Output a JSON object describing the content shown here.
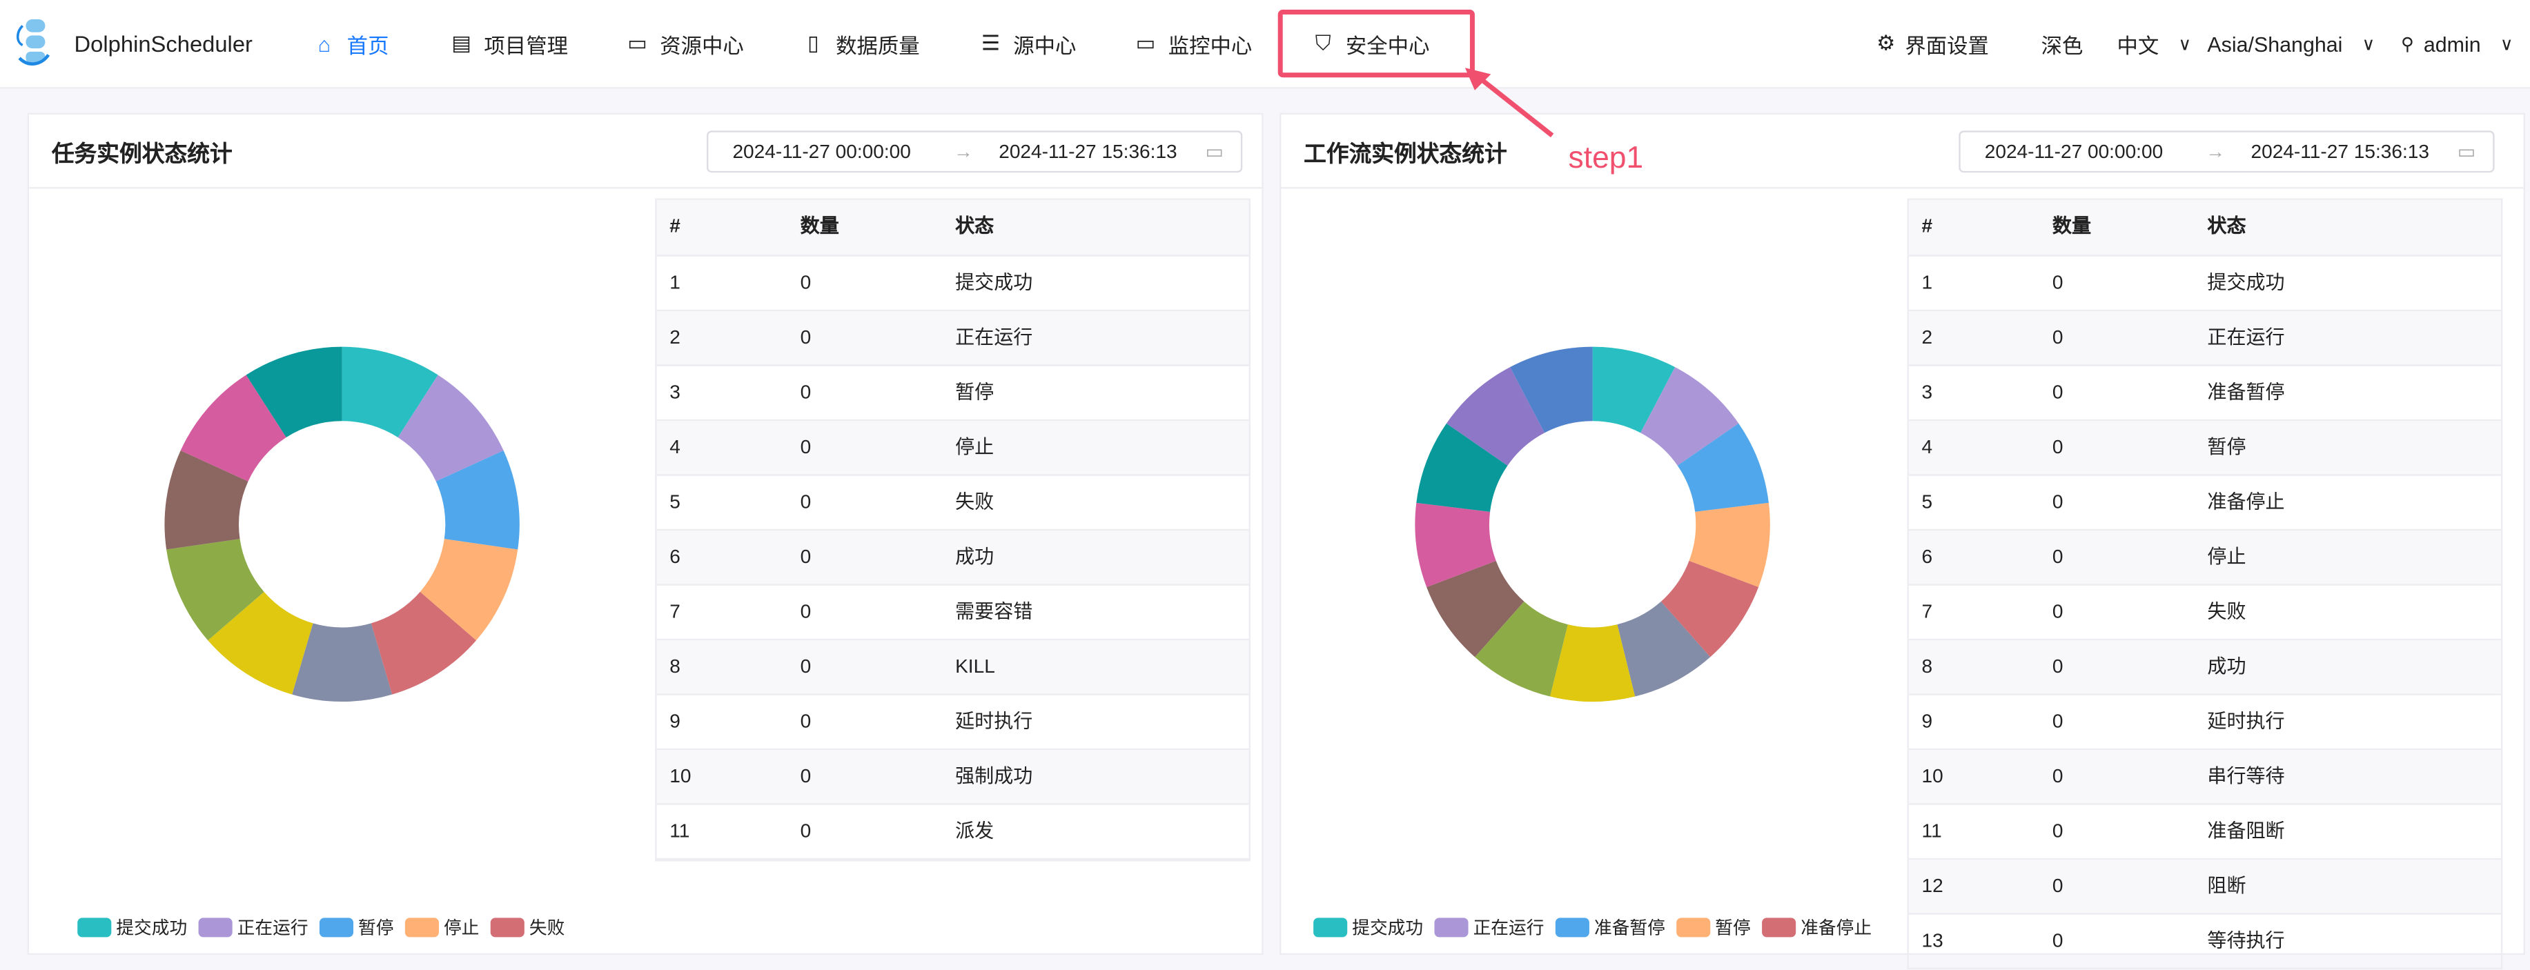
{
  "app": {
    "name": "DolphinScheduler"
  },
  "nav": [
    {
      "label": "首页",
      "icon": "home-icon",
      "active": true
    },
    {
      "label": "项目管理",
      "icon": "list-icon"
    },
    {
      "label": "资源中心",
      "icon": "folder-icon"
    },
    {
      "label": "数据质量",
      "icon": "document-check-icon"
    },
    {
      "label": "源中心",
      "icon": "database-icon"
    },
    {
      "label": "监控中心",
      "icon": "monitor-icon"
    },
    {
      "label": "安全中心",
      "icon": "shield-check-icon"
    }
  ],
  "header_right": {
    "ui_settings": "界面设置",
    "theme": "深色",
    "language": "中文",
    "timezone": "Asia/Shanghai",
    "user": "admin"
  },
  "annotation": {
    "label": "step1",
    "color": "#f0506e"
  },
  "cards": [
    {
      "title": "任务实例状态统计",
      "date_start": "2024-11-27 00:00:00",
      "date_end": "2024-11-27 15:36:13",
      "columns": [
        "#",
        "数量",
        "状态"
      ],
      "rows": [
        [
          "1",
          "0",
          "提交成功"
        ],
        [
          "2",
          "0",
          "正在运行"
        ],
        [
          "3",
          "0",
          "暂停"
        ],
        [
          "4",
          "0",
          "停止"
        ],
        [
          "5",
          "0",
          "失败"
        ],
        [
          "6",
          "0",
          "成功"
        ],
        [
          "7",
          "0",
          "需要容错"
        ],
        [
          "8",
          "0",
          "KILL"
        ],
        [
          "9",
          "0",
          "延时执行"
        ],
        [
          "10",
          "0",
          "强制成功"
        ],
        [
          "11",
          "0",
          "派发"
        ]
      ],
      "legend": [
        "提交成功",
        "正在运行",
        "暂停",
        "停止",
        "失败"
      ]
    },
    {
      "title": "工作流实例状态统计",
      "date_start": "2024-11-27 00:00:00",
      "date_end": "2024-11-27 15:36:13",
      "columns": [
        "#",
        "数量",
        "状态"
      ],
      "rows": [
        [
          "1",
          "0",
          "提交成功"
        ],
        [
          "2",
          "0",
          "正在运行"
        ],
        [
          "3",
          "0",
          "准备暂停"
        ],
        [
          "4",
          "0",
          "暂停"
        ],
        [
          "5",
          "0",
          "准备停止"
        ],
        [
          "6",
          "0",
          "停止"
        ],
        [
          "7",
          "0",
          "失败"
        ],
        [
          "8",
          "0",
          "成功"
        ],
        [
          "9",
          "0",
          "延时执行"
        ],
        [
          "10",
          "0",
          "串行等待"
        ],
        [
          "11",
          "0",
          "准备阻断"
        ],
        [
          "12",
          "0",
          "阻断"
        ],
        [
          "13",
          "0",
          "等待执行"
        ]
      ],
      "legend": [
        "提交成功",
        "正在运行",
        "准备暂停",
        "暂停",
        "准备停止"
      ]
    }
  ],
  "chart_data": [
    {
      "type": "pie",
      "donut": true,
      "title": "任务实例状态统计",
      "categories": [
        "提交成功",
        "正在运行",
        "暂停",
        "停止",
        "失败",
        "成功",
        "需要容错",
        "KILL",
        "延时执行",
        "强制成功",
        "派发"
      ],
      "values": [
        0,
        0,
        0,
        0,
        0,
        0,
        0,
        0,
        0,
        0,
        0
      ],
      "note": "all zero; drawn as equal slices"
    },
    {
      "type": "pie",
      "donut": true,
      "title": "工作流实例状态统计",
      "categories": [
        "提交成功",
        "正在运行",
        "准备暂停",
        "暂停",
        "准备停止",
        "停止",
        "失败",
        "成功",
        "延时执行",
        "串行等待",
        "准备阻断",
        "阻断",
        "等待执行"
      ],
      "values": [
        0,
        0,
        0,
        0,
        0,
        0,
        0,
        0,
        0,
        0,
        0,
        0,
        0
      ],
      "note": "all zero; drawn as equal slices"
    }
  ],
  "colors": {
    "accent": "#1677ff",
    "palette": [
      "#29bfc2",
      "#ab97d7",
      "#50a7eb",
      "#ffb074",
      "#d36e74",
      "#838da8",
      "#dfc80f",
      "#8dac48",
      "#8c6661",
      "#d55c9f",
      "#0a999a",
      "#8f77c8",
      "#5082cc"
    ]
  }
}
